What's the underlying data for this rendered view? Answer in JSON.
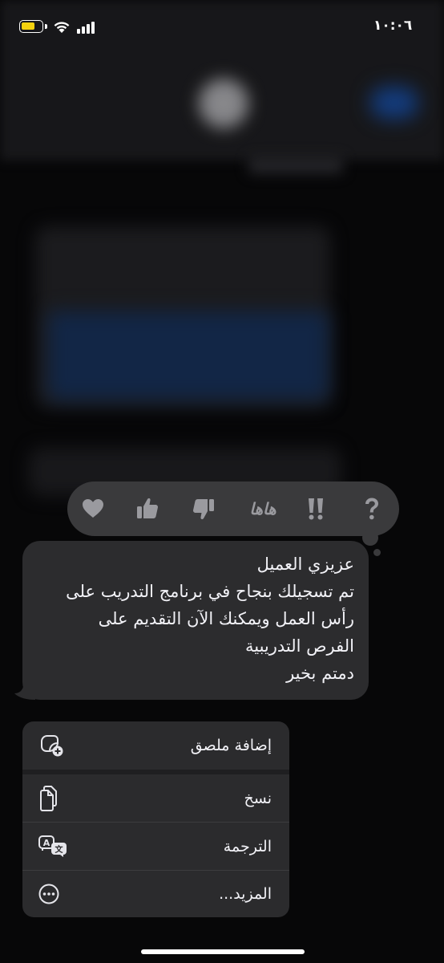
{
  "status_bar": {
    "time": "١٠:٠٦",
    "battery_level": 0.7,
    "battery_color": "#f5d20f"
  },
  "reactions": [
    {
      "name": "heart",
      "icon": "heart-icon"
    },
    {
      "name": "thumbs_up",
      "icon": "thumbs-up-icon"
    },
    {
      "name": "thumbs_down",
      "icon": "thumbs-down-icon"
    },
    {
      "name": "haha",
      "label": "هاها"
    },
    {
      "name": "emphasis",
      "icon": "double-exclamation-icon"
    },
    {
      "name": "question",
      "icon": "question-icon"
    }
  ],
  "message": {
    "text": "عزيزي العميل\nتم تسجيلك بنجاح في برنامج التدريب على\nرأس العمل ويمكنك الآن التقديم على\nالفرص التدريبية\nدمتم بخير"
  },
  "menu": {
    "items": [
      {
        "label": "إضافة ملصق",
        "icon": "add-sticker-icon"
      },
      {
        "label": "نسخ",
        "icon": "copy-icon"
      },
      {
        "label": "الترجمة",
        "icon": "translate-icon"
      },
      {
        "label": "المزيد...",
        "icon": "more-icon"
      }
    ]
  },
  "colors": {
    "reaction_bar": "#3a3a3c",
    "bubble": "#2c2c2e",
    "menu": "#2b2b2d",
    "icon_gray": "#9a9a9f"
  }
}
